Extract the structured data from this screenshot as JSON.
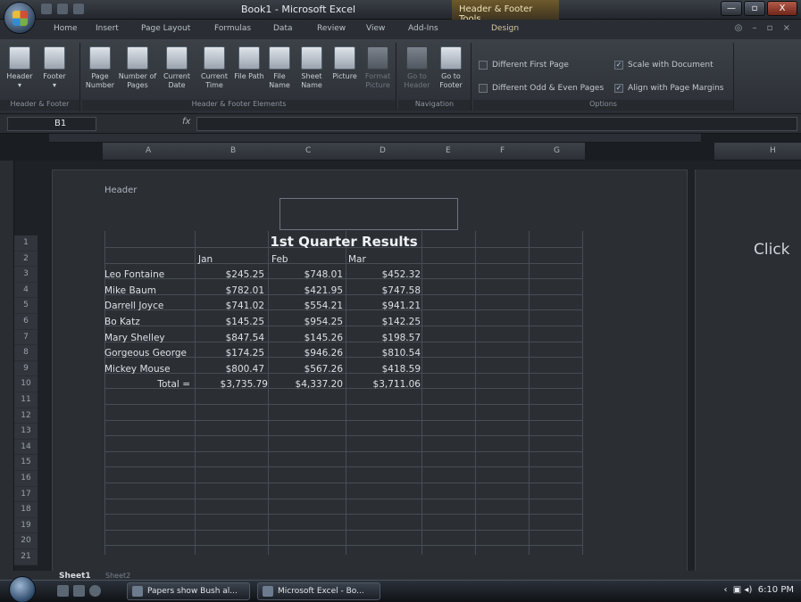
{
  "window": {
    "title": "Book1 - Microsoft Excel",
    "context_tab_title": "Header & Footer Tools",
    "minimize": "—",
    "maximize": "▫",
    "close": "X"
  },
  "tabs": [
    "Home",
    "Insert",
    "Page Layout",
    "Formulas",
    "Data",
    "Review",
    "View",
    "Add-Ins",
    "Design"
  ],
  "ribbon": {
    "groups": {
      "header_footer": "Header & Footer",
      "elements": "Header & Footer Elements",
      "navigation": "Navigation",
      "options": "Options"
    },
    "buttons": {
      "header": "Header",
      "footer": "Footer",
      "page_number": "Page Number",
      "number_of_pages": "Number of Pages",
      "current_date": "Current Date",
      "current_time": "Current Time",
      "file_path": "File Path",
      "file_name": "File Name",
      "sheet_name": "Sheet Name",
      "picture": "Picture",
      "format_picture": "Format Picture",
      "go_to_header": "Go to Header",
      "go_to_footer": "Go to Footer"
    },
    "options": {
      "different_first_page": "Different First Page",
      "different_odd_even": "Different Odd & Even Pages",
      "scale_with_document": "Scale with Document",
      "align_with_margins": "Align with Page Margins"
    }
  },
  "formula_bar": {
    "name_box": "B1",
    "fx": "fx"
  },
  "columns": [
    "A",
    "B",
    "C",
    "D",
    "E",
    "F",
    "G",
    "H"
  ],
  "rows": [
    "1",
    "2",
    "3",
    "4",
    "5",
    "6",
    "7",
    "8",
    "9",
    "10",
    "11",
    "12",
    "13",
    "14",
    "15",
    "16",
    "17",
    "18",
    "19",
    "20",
    "21"
  ],
  "page": {
    "header_label": "Header",
    "click_hint": "Click"
  },
  "spreadsheet": {
    "title": "1st Quarter Results",
    "months": [
      "Jan",
      "Feb",
      "Mar"
    ],
    "rows": [
      {
        "name": "Leo Fontaine",
        "jan": "$245.25",
        "feb": "$748.01",
        "mar": "$452.32"
      },
      {
        "name": "Mike Baum",
        "jan": "$782.01",
        "feb": "$421.95",
        "mar": "$747.58"
      },
      {
        "name": "Darrell Joyce",
        "jan": "$741.02",
        "feb": "$554.21",
        "mar": "$941.21"
      },
      {
        "name": "Bo Katz",
        "jan": "$145.25",
        "feb": "$954.25",
        "mar": "$142.25"
      },
      {
        "name": "Mary Shelley",
        "jan": "$847.54",
        "feb": "$145.26",
        "mar": "$198.57"
      },
      {
        "name": "Gorgeous George",
        "jan": "$174.25",
        "feb": "$946.26",
        "mar": "$810.54"
      },
      {
        "name": "Mickey Mouse",
        "jan": "$800.47",
        "feb": "$567.26",
        "mar": "$418.59"
      }
    ],
    "total_label": "Total =",
    "totals": {
      "jan": "$3,735.79",
      "feb": "$4,337.20",
      "mar": "$3,711.06"
    }
  },
  "sheet_tabs": [
    "Sheet1",
    "Sheet2"
  ],
  "taskbar": {
    "items": [
      "Papers show Bush al...",
      "Microsoft Excel - Bo..."
    ],
    "clock": "6:10 PM"
  }
}
